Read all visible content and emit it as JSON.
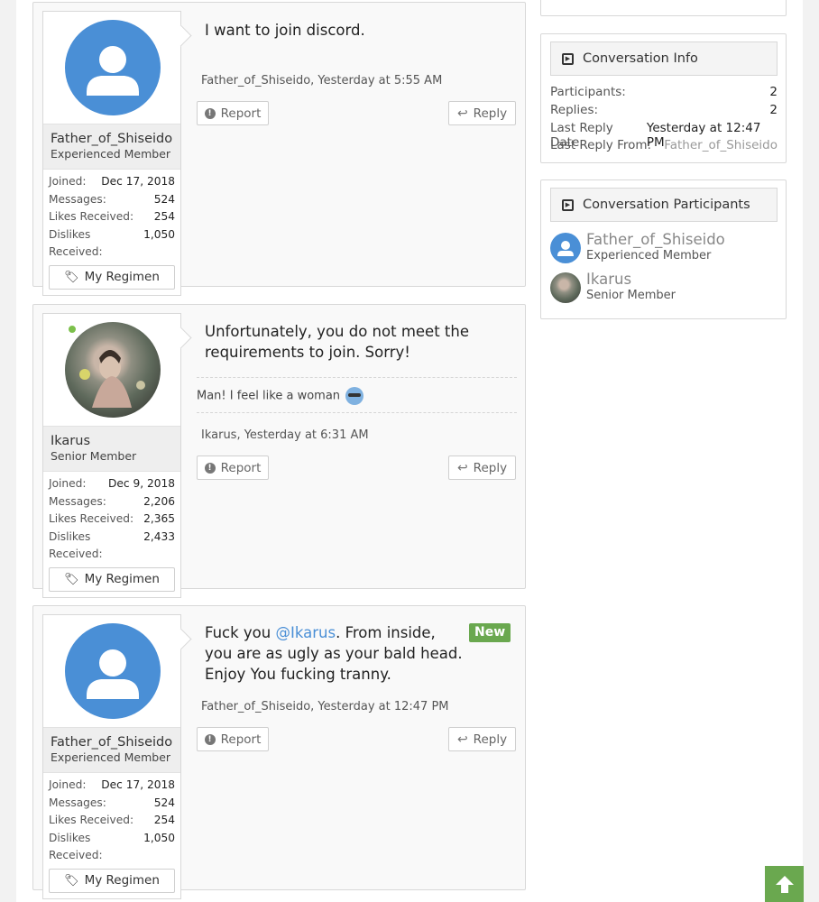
{
  "posts": [
    {
      "user": {
        "name": "Father_of_Shiseido",
        "title": "Experienced Member",
        "avatar": "default-user-icon",
        "online": false,
        "stats": [
          {
            "label": "Joined:",
            "value": "Dec 17, 2018"
          },
          {
            "label": "Messages:",
            "value": "524"
          },
          {
            "label": "Likes Received:",
            "value": "254"
          },
          {
            "label": "Dislikes Received:",
            "value": "1,050"
          }
        ],
        "regimen_label": "My Regimen"
      },
      "text": "I want to join discord.",
      "meta": "Father_of_Shiseido, Yesterday at 5:55 AM",
      "report_label": "Report",
      "reply_label": "Reply"
    },
    {
      "user": {
        "name": "Ikarus",
        "title": "Senior Member",
        "avatar": "photo-avatar",
        "online": true,
        "stats": [
          {
            "label": "Joined:",
            "value": "Dec 9, 2018"
          },
          {
            "label": "Messages:",
            "value": "2,206"
          },
          {
            "label": "Likes Received:",
            "value": "2,365"
          },
          {
            "label": "Dislikes Received:",
            "value": "2,433"
          }
        ],
        "regimen_label": "My Regimen"
      },
      "text": "Unfortunately, you do not meet the requirements to join. Sorry!",
      "signature": "Man! I feel like a woman",
      "meta": "Ikarus, Yesterday at 6:31 AM",
      "report_label": "Report",
      "reply_label": "Reply"
    },
    {
      "user": {
        "name": "Father_of_Shiseido",
        "title": "Experienced Member",
        "avatar": "default-user-icon",
        "online": false,
        "stats": [
          {
            "label": "Joined:",
            "value": "Dec 17, 2018"
          },
          {
            "label": "Messages:",
            "value": "524"
          },
          {
            "label": "Likes Received:",
            "value": "254"
          },
          {
            "label": "Dislikes Received:",
            "value": "1,050"
          }
        ],
        "regimen_label": "My Regimen"
      },
      "text_before": "Fuck you ",
      "mention": "@Ikarus",
      "text_after": ". From inside, you are as ugly as your bald head. Enjoy You fucking tranny.",
      "new_badge": "New",
      "meta": "Father_of_Shiseido, Yesterday at 12:47 PM",
      "report_label": "Report",
      "reply_label": "Reply"
    }
  ],
  "sidebar": {
    "info": {
      "title": "Conversation Info",
      "rows": [
        {
          "label": "Participants:",
          "value": "2"
        },
        {
          "label": "Replies:",
          "value": "2"
        },
        {
          "label": "Last Reply Date:",
          "value": "Yesterday at 12:47 PM"
        },
        {
          "label": "Last Reply From:",
          "value": "Father_of_Shiseido"
        }
      ]
    },
    "participants": {
      "title": "Conversation Participants",
      "items": [
        {
          "name": "Father_of_Shiseido",
          "title": "Experienced Member"
        },
        {
          "name": "Ikarus",
          "title": "Senior Member"
        }
      ]
    }
  },
  "colors": {
    "accent_blue": "#4a8fd6",
    "new_green": "#6aa84f",
    "online_green": "#7cc04b"
  },
  "scroll_top_icon": "arrow-up-icon"
}
